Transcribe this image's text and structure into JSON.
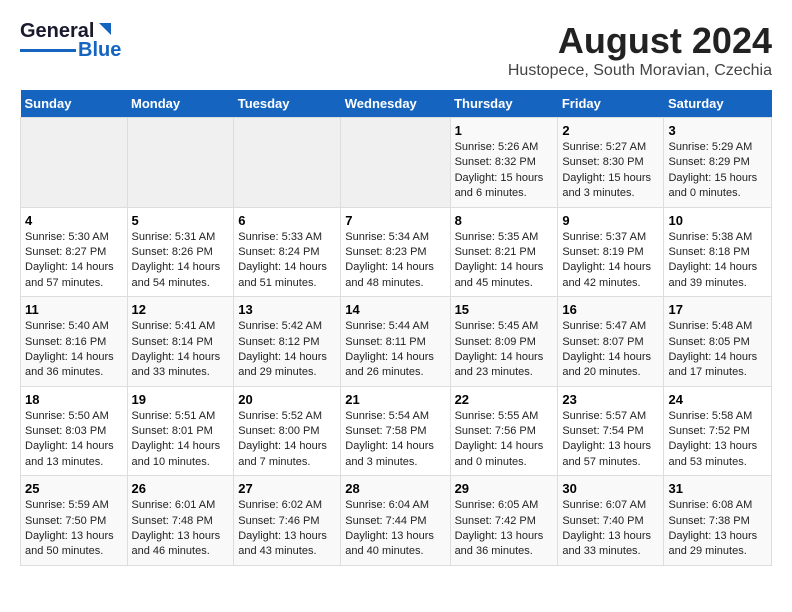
{
  "header": {
    "logo_general": "General",
    "logo_blue": "Blue",
    "title": "August 2024",
    "subtitle": "Hustopece, South Moravian, Czechia"
  },
  "days_of_week": [
    "Sunday",
    "Monday",
    "Tuesday",
    "Wednesday",
    "Thursday",
    "Friday",
    "Saturday"
  ],
  "weeks": [
    {
      "days": [
        {
          "num": "",
          "info": ""
        },
        {
          "num": "",
          "info": ""
        },
        {
          "num": "",
          "info": ""
        },
        {
          "num": "",
          "info": ""
        },
        {
          "num": "1",
          "info": "Sunrise: 5:26 AM\nSunset: 8:32 PM\nDaylight: 15 hours and 6 minutes."
        },
        {
          "num": "2",
          "info": "Sunrise: 5:27 AM\nSunset: 8:30 PM\nDaylight: 15 hours and 3 minutes."
        },
        {
          "num": "3",
          "info": "Sunrise: 5:29 AM\nSunset: 8:29 PM\nDaylight: 15 hours and 0 minutes."
        }
      ]
    },
    {
      "days": [
        {
          "num": "4",
          "info": "Sunrise: 5:30 AM\nSunset: 8:27 PM\nDaylight: 14 hours and 57 minutes."
        },
        {
          "num": "5",
          "info": "Sunrise: 5:31 AM\nSunset: 8:26 PM\nDaylight: 14 hours and 54 minutes."
        },
        {
          "num": "6",
          "info": "Sunrise: 5:33 AM\nSunset: 8:24 PM\nDaylight: 14 hours and 51 minutes."
        },
        {
          "num": "7",
          "info": "Sunrise: 5:34 AM\nSunset: 8:23 PM\nDaylight: 14 hours and 48 minutes."
        },
        {
          "num": "8",
          "info": "Sunrise: 5:35 AM\nSunset: 8:21 PM\nDaylight: 14 hours and 45 minutes."
        },
        {
          "num": "9",
          "info": "Sunrise: 5:37 AM\nSunset: 8:19 PM\nDaylight: 14 hours and 42 minutes."
        },
        {
          "num": "10",
          "info": "Sunrise: 5:38 AM\nSunset: 8:18 PM\nDaylight: 14 hours and 39 minutes."
        }
      ]
    },
    {
      "days": [
        {
          "num": "11",
          "info": "Sunrise: 5:40 AM\nSunset: 8:16 PM\nDaylight: 14 hours and 36 minutes."
        },
        {
          "num": "12",
          "info": "Sunrise: 5:41 AM\nSunset: 8:14 PM\nDaylight: 14 hours and 33 minutes."
        },
        {
          "num": "13",
          "info": "Sunrise: 5:42 AM\nSunset: 8:12 PM\nDaylight: 14 hours and 29 minutes."
        },
        {
          "num": "14",
          "info": "Sunrise: 5:44 AM\nSunset: 8:11 PM\nDaylight: 14 hours and 26 minutes."
        },
        {
          "num": "15",
          "info": "Sunrise: 5:45 AM\nSunset: 8:09 PM\nDaylight: 14 hours and 23 minutes."
        },
        {
          "num": "16",
          "info": "Sunrise: 5:47 AM\nSunset: 8:07 PM\nDaylight: 14 hours and 20 minutes."
        },
        {
          "num": "17",
          "info": "Sunrise: 5:48 AM\nSunset: 8:05 PM\nDaylight: 14 hours and 17 minutes."
        }
      ]
    },
    {
      "days": [
        {
          "num": "18",
          "info": "Sunrise: 5:50 AM\nSunset: 8:03 PM\nDaylight: 14 hours and 13 minutes."
        },
        {
          "num": "19",
          "info": "Sunrise: 5:51 AM\nSunset: 8:01 PM\nDaylight: 14 hours and 10 minutes."
        },
        {
          "num": "20",
          "info": "Sunrise: 5:52 AM\nSunset: 8:00 PM\nDaylight: 14 hours and 7 minutes."
        },
        {
          "num": "21",
          "info": "Sunrise: 5:54 AM\nSunset: 7:58 PM\nDaylight: 14 hours and 3 minutes."
        },
        {
          "num": "22",
          "info": "Sunrise: 5:55 AM\nSunset: 7:56 PM\nDaylight: 14 hours and 0 minutes."
        },
        {
          "num": "23",
          "info": "Sunrise: 5:57 AM\nSunset: 7:54 PM\nDaylight: 13 hours and 57 minutes."
        },
        {
          "num": "24",
          "info": "Sunrise: 5:58 AM\nSunset: 7:52 PM\nDaylight: 13 hours and 53 minutes."
        }
      ]
    },
    {
      "days": [
        {
          "num": "25",
          "info": "Sunrise: 5:59 AM\nSunset: 7:50 PM\nDaylight: 13 hours and 50 minutes."
        },
        {
          "num": "26",
          "info": "Sunrise: 6:01 AM\nSunset: 7:48 PM\nDaylight: 13 hours and 46 minutes."
        },
        {
          "num": "27",
          "info": "Sunrise: 6:02 AM\nSunset: 7:46 PM\nDaylight: 13 hours and 43 minutes."
        },
        {
          "num": "28",
          "info": "Sunrise: 6:04 AM\nSunset: 7:44 PM\nDaylight: 13 hours and 40 minutes."
        },
        {
          "num": "29",
          "info": "Sunrise: 6:05 AM\nSunset: 7:42 PM\nDaylight: 13 hours and 36 minutes."
        },
        {
          "num": "30",
          "info": "Sunrise: 6:07 AM\nSunset: 7:40 PM\nDaylight: 13 hours and 33 minutes."
        },
        {
          "num": "31",
          "info": "Sunrise: 6:08 AM\nSunset: 7:38 PM\nDaylight: 13 hours and 29 minutes."
        }
      ]
    }
  ]
}
